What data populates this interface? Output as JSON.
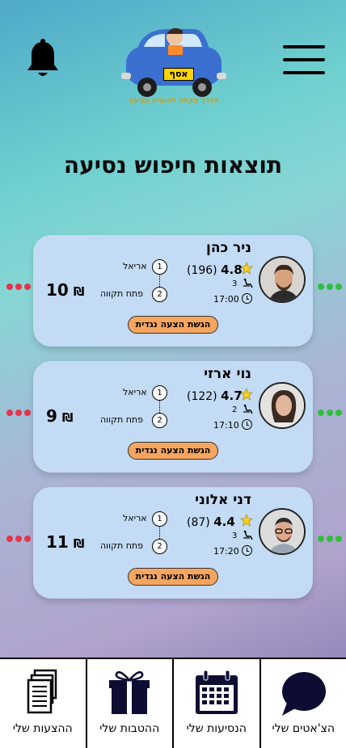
{
  "header": {
    "logo_plate": "אסף",
    "logo_slogan": "הדרך הקלה להוציא נסיעה"
  },
  "page": {
    "title": "תוצאות חיפוש נסיעה"
  },
  "rides": [
    {
      "driver": "ניר כהן",
      "rating": "4.8",
      "reviews": "(196)",
      "seats": "3",
      "time": "17:00",
      "from": "אריאל",
      "to": "פתח תקווה",
      "price": "10",
      "currency": "₪",
      "offer_label": "הגשת הצעה נגדית",
      "stop1": "1",
      "stop2": "2"
    },
    {
      "driver": "נוי ארזי",
      "rating": "4.7",
      "reviews": "(122)",
      "seats": "2",
      "time": "17:10",
      "from": "אריאל",
      "to": "פתח תקווה",
      "price": "9",
      "currency": "₪",
      "offer_label": "הגשת הצעה נגדית",
      "stop1": "1",
      "stop2": "2"
    },
    {
      "driver": "דני אלוני",
      "rating": "4.4",
      "reviews": "(87)",
      "seats": "3",
      "time": "17:20",
      "from": "אריאל",
      "to": "פתח תקווה",
      "price": "11",
      "currency": "₪",
      "offer_label": "הגשת הצעה נגדית",
      "stop1": "1",
      "stop2": "2"
    }
  ],
  "nav": [
    {
      "label": "ההצעות שלי",
      "icon": "documents-icon"
    },
    {
      "label": "ההטבות שלי",
      "icon": "gift-icon"
    },
    {
      "label": "הנסיעות שלי",
      "icon": "calendar-icon"
    },
    {
      "label": "הצ'אטים שלי",
      "icon": "chat-icon"
    }
  ],
  "colors": {
    "card": "#c3dbf4",
    "offer_button": "#f5a55f",
    "dot_left": "#e8334a",
    "dot_right": "#2fbf3c",
    "icon_dark": "#0d0d33"
  }
}
